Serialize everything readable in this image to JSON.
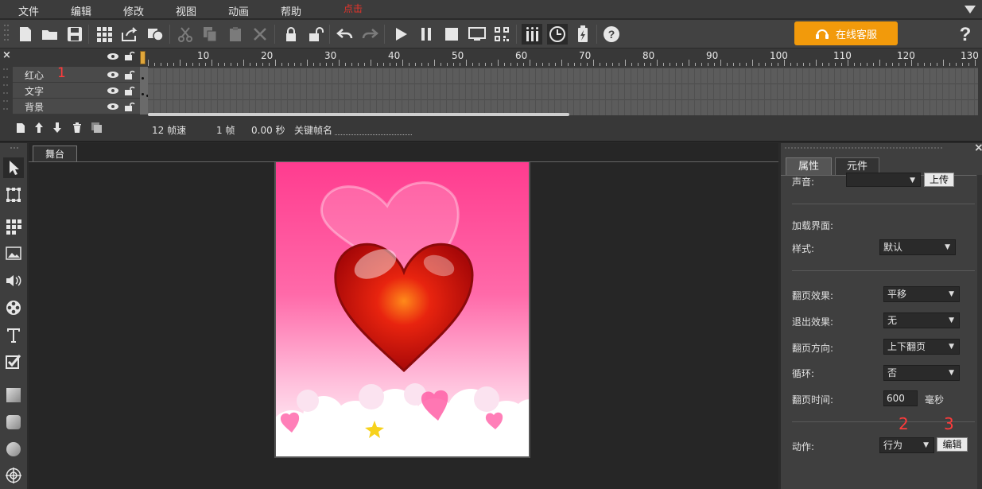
{
  "menu": [
    "文件",
    "编辑",
    "修改",
    "视图",
    "动画",
    "帮助"
  ],
  "menu_hint": "点击",
  "support_button": "在线客服",
  "ruler": [
    "10",
    "20",
    "30",
    "40",
    "50",
    "60",
    "70",
    "80",
    "90",
    "100",
    "110",
    "120",
    "130"
  ],
  "layers": [
    {
      "name": "红心",
      "marker": "1"
    },
    {
      "name": "文字"
    },
    {
      "name": "背景"
    }
  ],
  "timeline_info": {
    "fps": "12 帧速",
    "frame": "1 帧",
    "time": "0.00 秒",
    "keyframe_label": "关键帧名"
  },
  "stage_tab": "舞台",
  "props": {
    "tabs": [
      "属性",
      "元件"
    ],
    "sound_label": "声音:",
    "upload_button": "上传",
    "loading_label": "加载界面:",
    "style_label": "样式:",
    "style_value": "默认",
    "flip_effect_label": "翻页效果:",
    "flip_effect_value": "平移",
    "exit_effect_label": "退出效果:",
    "exit_effect_value": "无",
    "flip_direction_label": "翻页方向:",
    "flip_direction_value": "上下翻页",
    "loop_label": "循环:",
    "loop_value": "否",
    "flip_time_label": "翻页时间:",
    "flip_time_value": "600",
    "flip_time_unit": "毫秒",
    "action_label": "动作:",
    "action_value": "行为",
    "edit_button": "编辑",
    "marker_2": "2",
    "marker_3": "3"
  },
  "colors": {
    "accent": "#f29a0b",
    "marker": "#ff3b3b"
  }
}
